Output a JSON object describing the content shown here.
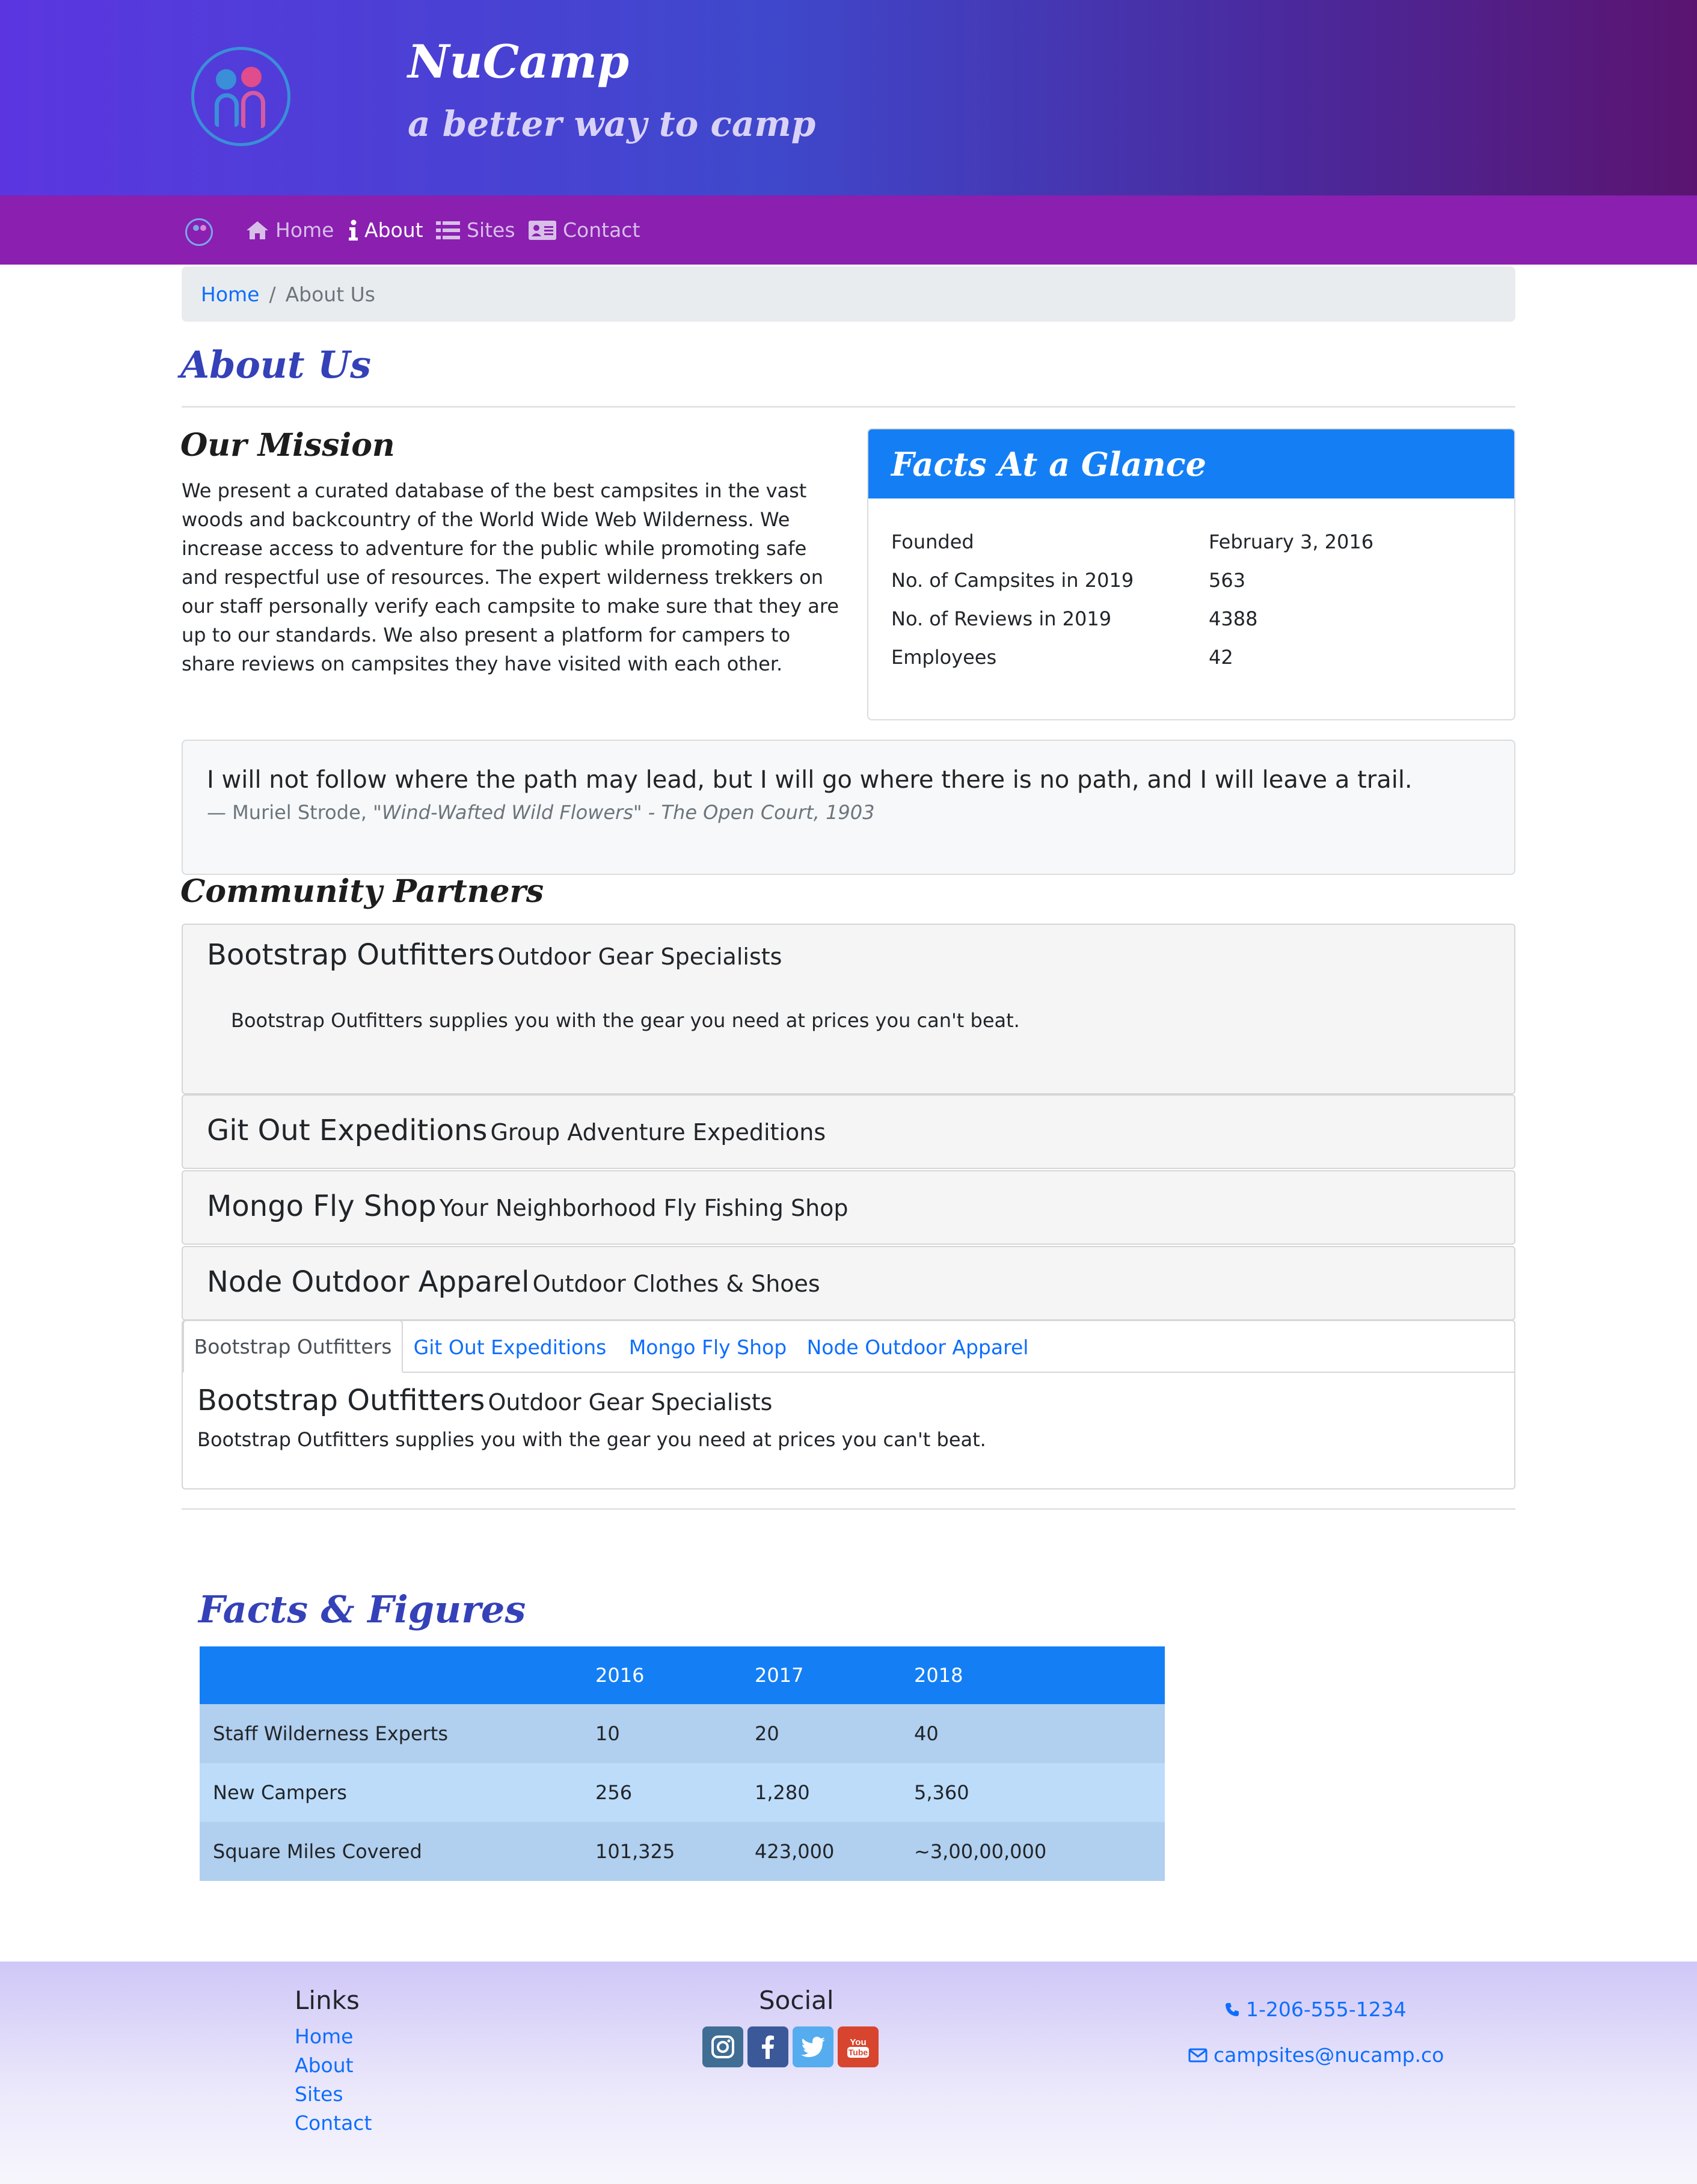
{
  "header": {
    "brand": "NuCamp",
    "tagline": "a better way to camp"
  },
  "nav": {
    "items": [
      {
        "label": "Home",
        "icon": "home-icon"
      },
      {
        "label": "About",
        "icon": "info-icon",
        "active": true
      },
      {
        "label": "Sites",
        "icon": "list-icon"
      },
      {
        "label": "Contact",
        "icon": "address-card-icon"
      }
    ]
  },
  "breadcrumb": {
    "home": "Home",
    "separator": "/",
    "current": "About Us"
  },
  "page": {
    "title": "About Us"
  },
  "mission": {
    "heading": "Our Mission",
    "text": "We present a curated database of the best campsites in the vast woods and backcountry of the World Wide Web Wilderness. We increase access to adventure for the public while promoting safe and respectful use of resources. The expert wilderness trekkers on our staff personally verify each campsite to make sure that they are up to our standards. We also present a platform for campers to share reviews on campsites they have visited with each other."
  },
  "facts": {
    "heading": "Facts At a Glance",
    "rows": [
      {
        "label": "Founded",
        "value": "February 3, 2016"
      },
      {
        "label": "No. of Campsites in 2019",
        "value": "563"
      },
      {
        "label": "No. of Reviews in 2019",
        "value": "4388"
      },
      {
        "label": "Employees",
        "value": "42"
      }
    ]
  },
  "quote": {
    "text": "I will not follow where the path may lead, but I will go where there is no path, and I will leave a trail.",
    "author": "— Muriel Strode,",
    "source": "\"Wind-Wafted Wild Flowers\" - The Open Court, 1903"
  },
  "partners": {
    "heading": "Community Partners",
    "accordion": [
      {
        "name": "Bootstrap Outfitters",
        "sub": "Outdoor Gear Specialists",
        "body": "Bootstrap Outfitters supplies you with the gear you need at prices you can't beat."
      },
      {
        "name": "Git Out Expeditions",
        "sub": "Group Adventure Expeditions"
      },
      {
        "name": "Mongo Fly Shop",
        "sub": "Your Neighborhood Fly Fishing Shop"
      },
      {
        "name": "Node Outdoor Apparel",
        "sub": "Outdoor Clothes & Shoes"
      }
    ],
    "tabs": [
      "Bootstrap Outfitters",
      "Git Out Expeditions",
      "Mongo Fly Shop",
      "Node Outdoor Apparel"
    ],
    "pane": {
      "name": "Bootstrap Outfitters",
      "sub": "Outdoor Gear Specialists",
      "body": "Bootstrap Outfitters supplies you with the gear you need at prices you can't beat."
    }
  },
  "figures": {
    "heading": "Facts & Figures",
    "columns": [
      "",
      "2016",
      "2017",
      "2018"
    ],
    "rows": [
      [
        "Staff Wilderness Experts",
        "10",
        "20",
        "40"
      ],
      [
        "New Campers",
        "256",
        "1,280",
        "5,360"
      ],
      [
        "Square Miles Covered",
        "101,325",
        "423,000",
        "~3,00,00,000"
      ]
    ]
  },
  "footer": {
    "links_heading": "Links",
    "links": [
      "Home",
      "About",
      "Sites",
      "Contact"
    ],
    "social_heading": "Social",
    "social": [
      {
        "icon": "instagram-icon",
        "color": "#3f6d94"
      },
      {
        "icon": "facebook-icon",
        "color": "#3b5998"
      },
      {
        "icon": "twitter-icon",
        "color": "#55acee"
      },
      {
        "icon": "youtube-icon",
        "color": "#d8452e"
      }
    ],
    "phone": "1-206-555-1234",
    "email": "campsites@nucamp.co"
  },
  "colors": {
    "primary": "#147ff5",
    "navbar": "#8a1fb0",
    "heading_blue": "#3441b8",
    "link": "#0d6efd"
  }
}
